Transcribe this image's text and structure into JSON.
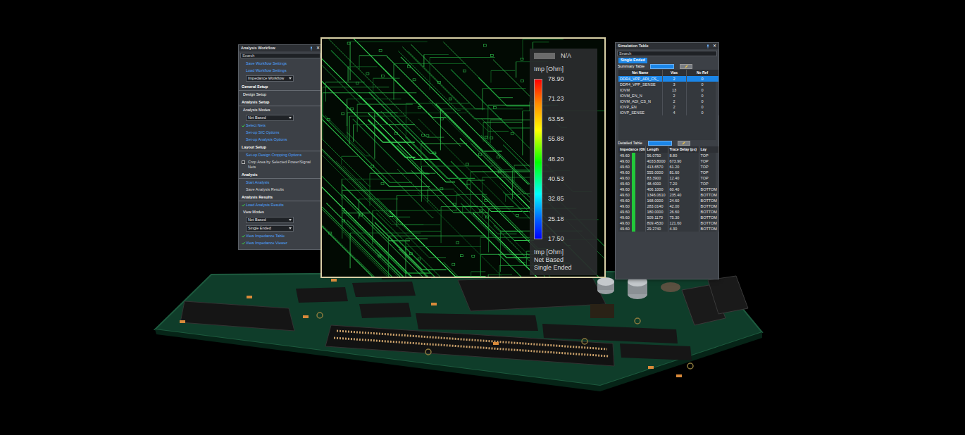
{
  "workflow": {
    "title": "Analysis Workflow",
    "close": "✕",
    "search": {
      "placeholder": "Search"
    },
    "items": [
      {
        "kind": "link",
        "text": "Save Workflow Settings",
        "checked": false
      },
      {
        "kind": "link",
        "text": "Load Workflow Settings",
        "checked": false
      },
      {
        "kind": "dropdown",
        "text": "Impedance Workflow"
      },
      {
        "kind": "header",
        "text": "General Setup"
      },
      {
        "kind": "subheader",
        "text": "Design Setup"
      },
      {
        "kind": "header",
        "text": "Analysis Setup"
      },
      {
        "kind": "subheader",
        "text": "Analysis Modes"
      },
      {
        "kind": "dropdown",
        "text": "Net Based"
      },
      {
        "kind": "link",
        "text": "Select Nets",
        "checked": true
      },
      {
        "kind": "link",
        "text": "Set-up SIC Options",
        "checked": false
      },
      {
        "kind": "link",
        "text": "Set-up Analysis Options",
        "checked": false
      },
      {
        "kind": "header",
        "text": "Layout Setup"
      },
      {
        "kind": "link",
        "text": "Set-up Design Cropping Options",
        "checked": false
      },
      {
        "kind": "checkbox",
        "text": "Crop Area by Selected Power/Signal Nets",
        "checked": false
      },
      {
        "kind": "header",
        "text": "Analysis"
      },
      {
        "kind": "link",
        "text": "Start Analysis",
        "checked": false
      },
      {
        "kind": "plain",
        "text": "Save Analysis Results"
      },
      {
        "kind": "header",
        "text": "Analysis Results"
      },
      {
        "kind": "link",
        "text": "Load Analysis Results",
        "checked": true
      },
      {
        "kind": "subheader",
        "text": "View Modes"
      },
      {
        "kind": "dropdown",
        "text": "Net Based"
      },
      {
        "kind": "dropdown",
        "text": "Single Ended"
      },
      {
        "kind": "link",
        "text": "View Impedance Table",
        "checked": true
      },
      {
        "kind": "link",
        "text": "View Impedance Viewer",
        "checked": true
      }
    ]
  },
  "viewer": {
    "na_label": "N/A",
    "unit_top": "Imp [Ohm]",
    "ticks": [
      "78.90",
      "71.23",
      "63.55",
      "55.88",
      "48.20",
      "40.53",
      "32.85",
      "25.18",
      "17.50"
    ],
    "unit_bottom": "Imp [Ohm]",
    "mode": "Net Based",
    "type": "Single Ended"
  },
  "simulation": {
    "title": "Simulation Table",
    "close": "✕",
    "search": {
      "placeholder": "Search"
    },
    "tabs": [
      {
        "label": "Single Ended",
        "selected": true
      }
    ],
    "summary_label": "Summary Table",
    "summary_columns": [
      "Net Name",
      "Vias",
      "No Ref"
    ],
    "summary_rows": [
      {
        "cells": [
          "DDR4_VPP_ADI_CS_",
          "2",
          "0"
        ],
        "selected": true
      },
      {
        "cells": [
          "DDR4_VPP_SENSE",
          "3",
          "0"
        ],
        "selected": false
      },
      {
        "cells": [
          "IOVM",
          "13",
          "0"
        ],
        "selected": false
      },
      {
        "cells": [
          "IOVM_EN_N",
          "2",
          "0"
        ],
        "selected": false
      },
      {
        "cells": [
          "IOVM_ADI_CS_N",
          "2",
          "0"
        ],
        "selected": false
      },
      {
        "cells": [
          "IOVP_EN",
          "2",
          "0"
        ],
        "selected": false
      },
      {
        "cells": [
          "IOVP_SENSE",
          "4",
          "0"
        ],
        "selected": false
      }
    ],
    "detail_label": "Detailed Table",
    "detail_columns": [
      "Impedance (Oh",
      "Length",
      "Trace Delay (ps)",
      "Lay"
    ],
    "detail_rows": [
      {
        "cells": [
          "49.60",
          "56.0750",
          "8.80",
          "TOP"
        ],
        "color": "#22c93a"
      },
      {
        "cells": [
          "49.60",
          "4033.8000",
          "673.90",
          "TOP"
        ],
        "color": "#22c93a"
      },
      {
        "cells": [
          "49.60",
          "413.6570",
          "61.20",
          "TOP"
        ],
        "color": "#22c93a"
      },
      {
        "cells": [
          "49.60",
          "555.0000",
          "81.60",
          "TOP"
        ],
        "color": "#22c93a"
      },
      {
        "cells": [
          "49.60",
          "83.3900",
          "12.40",
          "TOP"
        ],
        "color": "#22c93a"
      },
      {
        "cells": [
          "49.60",
          "48.4000",
          "7.20",
          "TOP"
        ],
        "color": "#22c93a"
      },
      {
        "cells": [
          "49.60",
          "406.1000",
          "60.40",
          "BOTTOM"
        ],
        "color": "#22c93a"
      },
      {
        "cells": [
          "49.60",
          "1346.0610",
          "235.40",
          "BOTTOM"
        ],
        "color": "#22c93a"
      },
      {
        "cells": [
          "49.60",
          "168.0000",
          "24.60",
          "BOTTOM"
        ],
        "color": "#22c93a"
      },
      {
        "cells": [
          "49.60",
          "283.0140",
          "42.00",
          "BOTTOM"
        ],
        "color": "#22c93a"
      },
      {
        "cells": [
          "49.60",
          "180.0000",
          "26.60",
          "BOTTOM"
        ],
        "color": "#22c93a"
      },
      {
        "cells": [
          "49.60",
          "509.1170",
          "75.30",
          "BOTTOM"
        ],
        "color": "#22c93a"
      },
      {
        "cells": [
          "49.60",
          "809.4530",
          "121.60",
          "BOTTOM"
        ],
        "color": "#22c93a"
      },
      {
        "cells": [
          "49.60",
          "29.2740",
          "4.30",
          "BOTTOM"
        ],
        "color": "#22c93a"
      }
    ]
  }
}
